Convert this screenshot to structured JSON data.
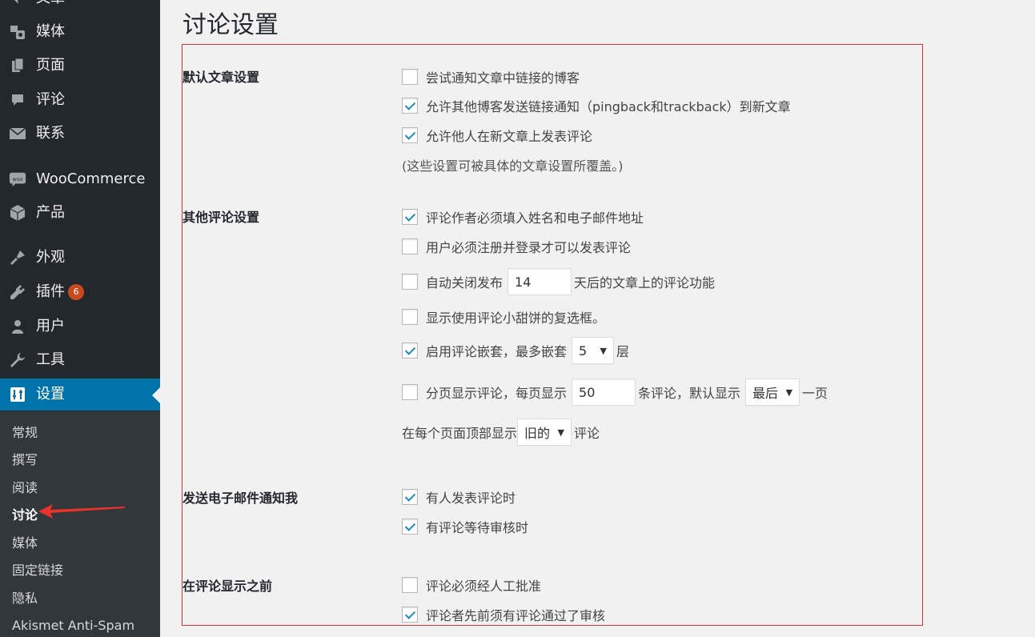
{
  "sidebar": {
    "items": [
      {
        "label": "文章",
        "icon": "pin-icon"
      },
      {
        "label": "媒体",
        "icon": "media-icon"
      },
      {
        "label": "页面",
        "icon": "page-icon"
      },
      {
        "label": "评论",
        "icon": "comment-icon"
      },
      {
        "label": "联系",
        "icon": "mail-icon"
      },
      {
        "label": "WooCommerce",
        "icon": "woo-icon"
      },
      {
        "label": "产品",
        "icon": "box-icon"
      },
      {
        "label": "外观",
        "icon": "brush-icon"
      },
      {
        "label": "插件",
        "icon": "plugin-icon",
        "badge": "6"
      },
      {
        "label": "用户",
        "icon": "user-icon"
      },
      {
        "label": "工具",
        "icon": "wrench-icon"
      },
      {
        "label": "设置",
        "icon": "settings-icon"
      }
    ],
    "submenu": [
      "常规",
      "撰写",
      "阅读",
      "讨论",
      "媒体",
      "固定链接",
      "隐私",
      "Akismet Anti-Spam"
    ]
  },
  "colors": {
    "sidebar_bg": "#23282d",
    "submenu_bg": "#32373c",
    "active_bg": "#0073aa",
    "badge": "#ca4a1f",
    "highlight": "#d63638",
    "checkmark": "#1e8cbe"
  },
  "page": {
    "title": "讨论设置"
  },
  "sections": {
    "default_article": {
      "title": "默认文章设置",
      "opt1": "尝试通知文章中链接的博客",
      "opt2": "允许其他博客发送链接通知（pingback和trackback）到新文章",
      "opt3": "允许他人在新文章上发表评论",
      "note": "(这些设置可被具体的文章设置所覆盖。)"
    },
    "other_comment": {
      "title": "其他评论设置",
      "opt1": "评论作者必须填入姓名和电子邮件地址",
      "opt2": "用户必须注册并登录才可以发表评论",
      "opt3_before": "自动关闭发布",
      "opt3_value": "14",
      "opt3_after": "天后的文章上的评论功能",
      "opt4": "显示使用评论小甜饼的复选框。",
      "opt5_before": "启用评论嵌套，最多嵌套",
      "opt5_value": "5",
      "opt5_after": "层",
      "opt6_before": "分页显示评论，每页显示",
      "opt6_value": "50",
      "opt6_middle": "条评论，默认显示",
      "opt6_select": "最后",
      "opt6_after": "一页",
      "opt7_before": "在每个页面顶部显示",
      "opt7_select": "旧的",
      "opt7_after": "评论"
    },
    "email_me": {
      "title": "发送电子邮件通知我",
      "opt1": "有人发表评论时",
      "opt2": "有评论等待审核时"
    },
    "before_appear": {
      "title": "在评论显示之前",
      "opt1": "评论必须经人工批准",
      "opt2": "评论者先前须有评论通过了审核"
    }
  }
}
